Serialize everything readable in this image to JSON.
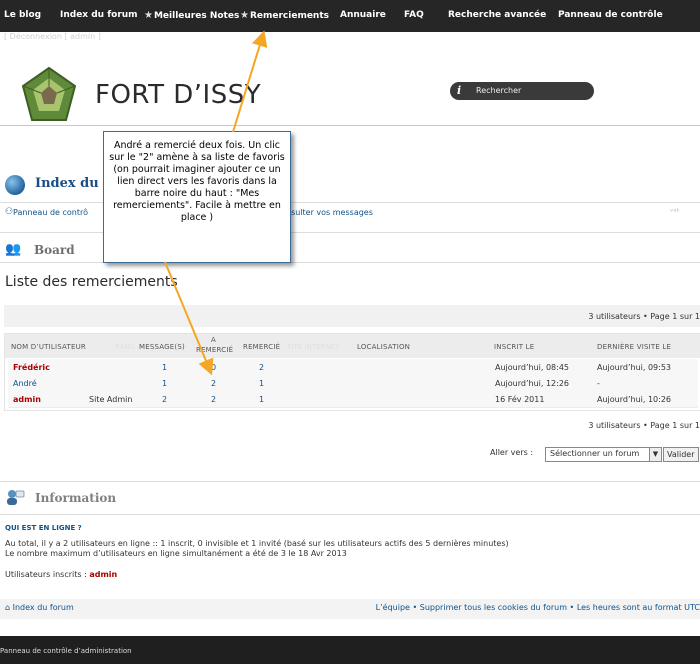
{
  "nav": {
    "items": [
      {
        "label": "Le blog"
      },
      {
        "label": "Index du forum"
      },
      {
        "label": "Meilleures Notes"
      },
      {
        "label": "Remerciements"
      },
      {
        "label": "Annuaire"
      },
      {
        "label": "FAQ"
      },
      {
        "label": "Recherche avancée"
      },
      {
        "label": "Panneau de contrôle"
      }
    ]
  },
  "subbar": {
    "text": "[ Déconnexion [ admin ]"
  },
  "header": {
    "logo_text": "FORT D’ISSY",
    "search_label": "Rechercher"
  },
  "index_section": {
    "title": "Index du fo",
    "ucp_link": "Panneau de contrô",
    "messages_link": "nsulter vos messages",
    "corner": "ᵛᵃᵏ"
  },
  "board": {
    "title": "Board"
  },
  "page": {
    "title": "Liste des remerciements",
    "pagination_top": "3 utilisateurs • Page 1 sur 1",
    "pagination_bottom": "3 utilisateurs • Page 1 sur 1"
  },
  "table": {
    "headers": {
      "username": "NOM D’UTILISATEUR",
      "rank_ghost": "RANG",
      "posts": "MESSAGE(S)",
      "thanked_top": "A",
      "thanked_bottom": "REMERCIÉ",
      "received": "REMERCIÉ",
      "website_ghost": "SITE INTERNET",
      "location": "LOCALISATION",
      "joined": "INSCRIT LE",
      "last_visit": "DERNIÈRE VISITE LE"
    },
    "rows": [
      {
        "name": "Frédéric",
        "rank": "",
        "posts": "1",
        "thanked": "0",
        "received": "2",
        "joined": "Aujourd’hui, 08:45",
        "last": "Aujourd’hui, 09:53"
      },
      {
        "name": "André",
        "rank": "",
        "posts": "1",
        "thanked": "2",
        "received": "1",
        "joined": "Aujourd’hui, 12:26",
        "last": "-"
      },
      {
        "name": "admin",
        "rank": "Site Admin",
        "posts": "2",
        "thanked": "2",
        "received": "1",
        "joined": "16 Fév 2011",
        "last": "Aujourd’hui, 10:26"
      }
    ]
  },
  "jump": {
    "label": "Aller vers :",
    "select_value": "Sélectionner un forum",
    "button": "Valider"
  },
  "info": {
    "title": "Information",
    "who_title": "QUI EST EN LIGNE ?",
    "line1": "Au total, il y a 2 utilisateurs en ligne :: 1 inscrit, 0 invisible et 1 invité (basé sur les utilisateurs actifs des 5 dernières minutes)",
    "line2": "Le nombre maximum d’utilisateurs en ligne simultanément a été de 3 le 18 Avr 2013",
    "registered_label": "Utilisateurs inscrits :",
    "registered_user": "admin"
  },
  "footer": {
    "home": "Index du forum",
    "links": "L’équipe • Supprimer tous les cookies du forum • Les heures sont au format UTC",
    "acp": "Panneau de contrôle d’administration"
  },
  "annotation": {
    "text": "André a remercié deux fois. Un clic sur le \"2\"  amène à sa liste de favoris (on pourrait imaginer ajouter ce un lien direct vers les favoris dans la barre noire du haut : \"Mes remerciements\". Facile à mettre en place )"
  },
  "colors": {
    "nav_bg": "#262626",
    "admin_red": "#aa0000",
    "link_blue": "#105289",
    "arrow_orange": "#f5a623"
  }
}
